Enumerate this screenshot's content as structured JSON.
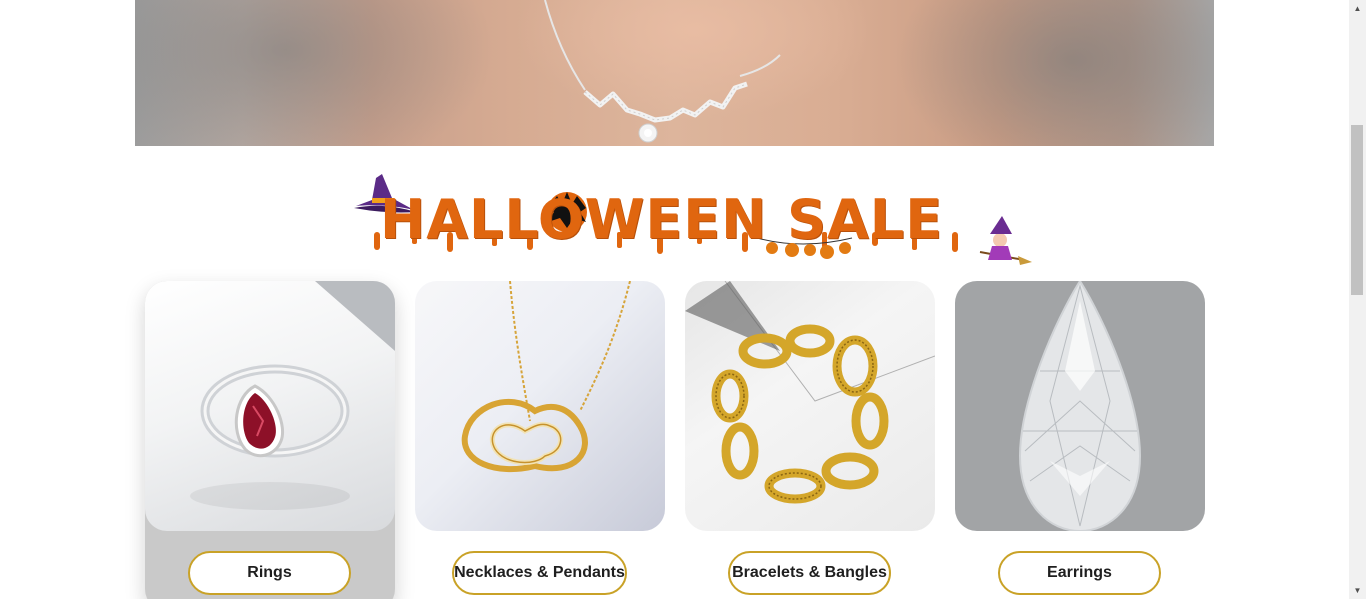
{
  "hero": {
    "image": "model-neck-diamond-necklace"
  },
  "banner": {
    "title": "HALLOWEEN SALE",
    "decor": [
      "witch-hat-icon",
      "bat-icon",
      "pumpkin-garland-icon",
      "witch-on-broom-icon"
    ]
  },
  "categories": [
    {
      "label": "Rings",
      "image": "ruby-halo-ring",
      "active": true
    },
    {
      "label": "Necklaces & Pendants",
      "image": "gold-heart-pendant-necklace",
      "active": false
    },
    {
      "label": "Bracelets & Bangles",
      "image": "gold-chain-bracelet",
      "active": false
    },
    {
      "label": "Earrings",
      "image": "pear-cut-diamond",
      "active": false
    }
  ],
  "colors": {
    "accent": "#c9a227",
    "banner_text": "#e0660f",
    "active_card_bg": "#c9c9c9"
  }
}
